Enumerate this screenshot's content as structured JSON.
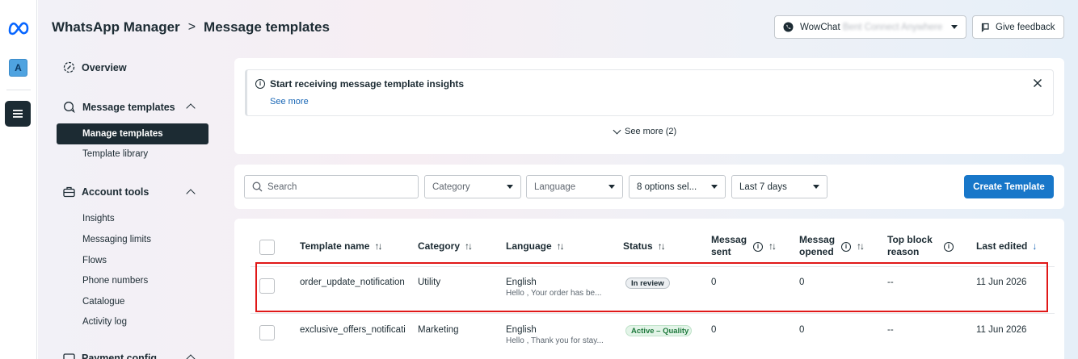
{
  "header": {
    "app_name": "WhatsApp Manager",
    "separator": ">",
    "page_title": "Message templates",
    "account_name": "WowChat",
    "account_name_obscured": "Bent Connect Anywhere",
    "feedback_label": "Give feedback"
  },
  "rail": {
    "avatar_letter": "A"
  },
  "nav": {
    "overview": "Overview",
    "message_templates": "Message templates",
    "manage_templates": "Manage templates",
    "template_library": "Template library",
    "account_tools": "Account tools",
    "insights": "Insights",
    "messaging_limits": "Messaging limits",
    "flows": "Flows",
    "phone_numbers": "Phone numbers",
    "catalogue": "Catalogue",
    "activity_log": "Activity log",
    "payment_config": "Payment config"
  },
  "insight": {
    "title": "Start receiving message template insights",
    "link": "See more",
    "more": "See more (2)"
  },
  "filters": {
    "search_placeholder": "Search",
    "category": "Category",
    "language": "Language",
    "status": "8 options sel...",
    "date_range": "Last 7 days",
    "create_label": "Create Template"
  },
  "table": {
    "headers": {
      "name": "Template name",
      "category": "Category",
      "language": "Language",
      "status": "Status",
      "sent_1": "Messag",
      "sent_2": "sent",
      "opened_1": "Messag",
      "opened_2": "opened",
      "block_1": "Top block",
      "block_2": "reason",
      "edited": "Last edited",
      "sort_both": "↑↓",
      "sort_down": "↓"
    },
    "rows": [
      {
        "name": "order_update_notification",
        "category": "Utility",
        "language": "English",
        "preview": "Hello , Your order has be...",
        "status": "In review",
        "sent": "0",
        "opened": "0",
        "block_reason": "--",
        "last_edited": "11 Jun 2026"
      },
      {
        "name": "exclusive_offers_notificati",
        "category": "Marketing",
        "language": "English",
        "preview": "Hello , Thank you for stay...",
        "status": "Active – Quality p",
        "sent": "0",
        "opened": "0",
        "block_reason": "--",
        "last_edited": "11 Jun 2026"
      }
    ]
  },
  "colors": {
    "primary_button": "#1877c9",
    "active_nav": "#1c2b33",
    "highlight_box": "#e01818",
    "link": "#1866b5"
  }
}
